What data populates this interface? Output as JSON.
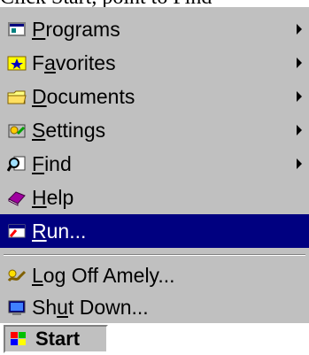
{
  "caption": "Click Start, point to Find",
  "menu": {
    "items": [
      {
        "pre": "",
        "key": "P",
        "post": "rograms",
        "icon": "programs-icon",
        "has_submenu": true
      },
      {
        "pre": "F",
        "key": "a",
        "post": "vorites",
        "icon": "favorites-icon",
        "has_submenu": true
      },
      {
        "pre": "",
        "key": "D",
        "post": "ocuments",
        "icon": "documents-icon",
        "has_submenu": true
      },
      {
        "pre": "",
        "key": "S",
        "post": "ettings",
        "icon": "settings-icon",
        "has_submenu": true
      },
      {
        "pre": "",
        "key": "F",
        "post": "ind",
        "icon": "find-icon",
        "has_submenu": true
      },
      {
        "pre": "",
        "key": "H",
        "post": "elp",
        "icon": "help-icon",
        "has_submenu": false
      },
      {
        "pre": "",
        "key": "R",
        "post": "un...",
        "icon": "run-icon",
        "has_submenu": false,
        "selected": true
      }
    ],
    "bottom_items": [
      {
        "pre": "",
        "key": "L",
        "post": "og Off Amely...",
        "icon": "log-off-icon"
      },
      {
        "pre": "Sh",
        "key": "u",
        "post": "t Down...",
        "icon": "shut-down-icon"
      }
    ]
  },
  "taskbar": {
    "start_label": "Start",
    "start_icon": "windows-logo-icon"
  },
  "colors": {
    "menu_bg": "#c0c0c0",
    "selection": "#000080"
  }
}
